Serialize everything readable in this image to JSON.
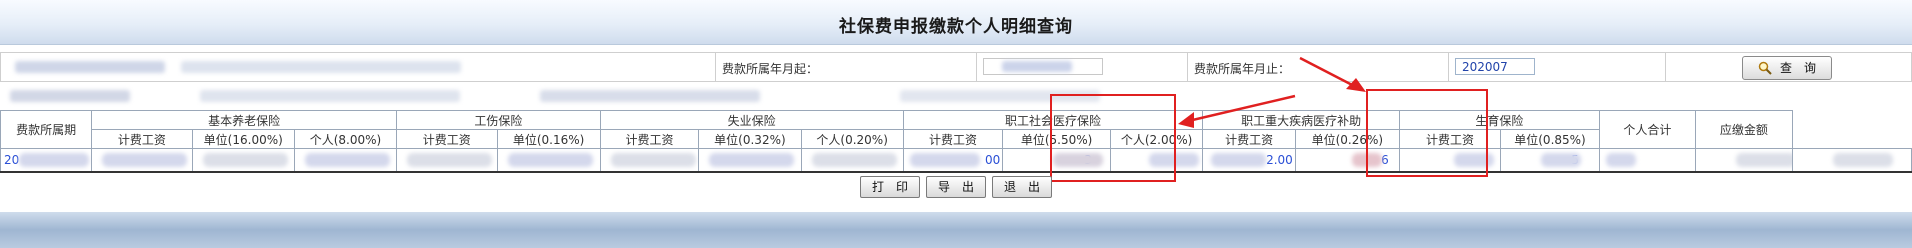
{
  "page": {
    "title": "社保费申报缴款个人明细查询"
  },
  "filter": {
    "start_label": "费款所属年月起：",
    "end_label": "费款所属年月止：",
    "end_value": "202007",
    "query_button": "查　询"
  },
  "table": {
    "period_header": "费款所属期",
    "groups": [
      {
        "name": "基本养老保险",
        "columns": [
          "计费工资",
          "单位(16.00%)",
          "个人(8.00%)"
        ]
      },
      {
        "name": "工伤保险",
        "columns": [
          "计费工资",
          "单位(0.16%)"
        ]
      },
      {
        "name": "失业保险",
        "columns": [
          "计费工资",
          "单位(0.32%)",
          "个人(0.20%)"
        ]
      },
      {
        "name": "职工社会医疗保险",
        "columns": [
          "计费工资",
          "单位(5.50%)",
          "个人(2.00%)"
        ]
      },
      {
        "name": "职工重大疾病医疗补助",
        "columns": [
          "计费工资",
          "单位(0.26%)"
        ]
      },
      {
        "name": "生育保险",
        "columns": [
          "计费工资",
          "单位(0.85%)"
        ]
      }
    ],
    "personal_total_header": "个人合计",
    "amount_due_header": "应缴金额",
    "row": {
      "period": "20",
      "medical_wage": "00",
      "medical_unit": "3",
      "serious_wage": "2.00",
      "serious_unit": "6",
      "maternity_unit": "5"
    }
  },
  "actions": {
    "print": "打　印",
    "export": "导　出",
    "exit": "退　出"
  },
  "colors": {
    "highlight": "#e02020",
    "link": "#2a4fd6"
  }
}
